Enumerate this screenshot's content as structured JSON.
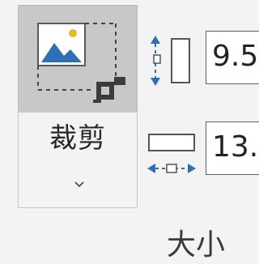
{
  "crop": {
    "label": "裁剪",
    "icon": "crop-picture-icon",
    "dropdown_icon": "chevron-down-icon"
  },
  "size": {
    "height_value": "9.5",
    "width_value": "13.",
    "height_icon": "shape-height-icon",
    "width_icon": "shape-width-icon",
    "group_label": "大小"
  },
  "colors": {
    "ribbon_bg": "#f3f3f3",
    "pressed_bg": "#c8c8c8",
    "icon_blue": "#2f6fb3",
    "icon_gold": "#e8b82a"
  }
}
